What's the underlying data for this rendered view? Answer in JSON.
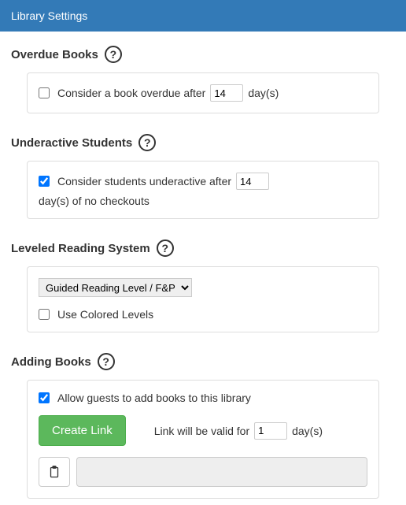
{
  "header": {
    "title": "Library Settings"
  },
  "overdue": {
    "title": "Overdue Books",
    "checkbox_checked": false,
    "label_before": "Consider a book overdue after",
    "days_value": "14",
    "label_after": "day(s)"
  },
  "underactive": {
    "title": "Underactive Students",
    "checkbox_checked": true,
    "label_before": "Consider students underactive after",
    "days_value": "14",
    "label_after": "day(s) of no checkouts"
  },
  "leveled": {
    "title": "Leveled Reading System",
    "select_value": "Guided Reading Level / F&P",
    "options": [
      "Guided Reading Level / F&P"
    ],
    "colored_checked": false,
    "colored_label": "Use Colored Levels"
  },
  "adding": {
    "title": "Adding Books",
    "allow_checked": true,
    "allow_label": "Allow guests to add books to this library",
    "create_link_label": "Create Link",
    "valid_label_before": "Link will be valid for",
    "valid_days_value": "1",
    "valid_label_after": "day(s)",
    "link_output": ""
  },
  "icons": {
    "help": "?",
    "clipboard": "📋"
  }
}
